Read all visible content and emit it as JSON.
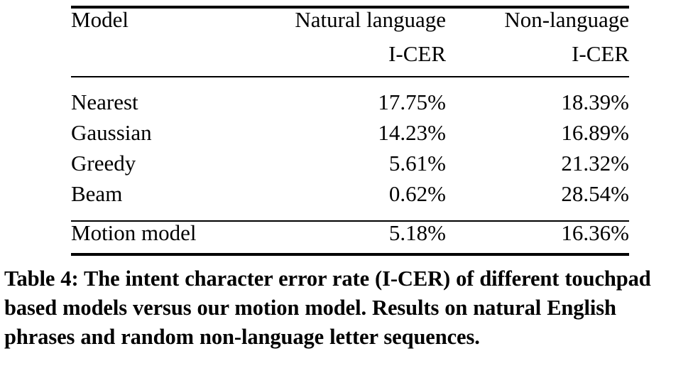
{
  "table": {
    "columns": [
      {
        "id": "model",
        "header_line1": "Model",
        "header_line2": "",
        "align": "left"
      },
      {
        "id": "natural_language",
        "header_line1": "Natural language",
        "header_line2": "I-CER",
        "align": "right"
      },
      {
        "id": "non_language",
        "header_line1": "Non-language",
        "header_line2": "I-CER",
        "align": "right"
      }
    ],
    "rows": [
      {
        "model": "Nearest",
        "natural_language": "17.75%",
        "non_language": "18.39%"
      },
      {
        "model": "Gaussian",
        "natural_language": "14.23%",
        "non_language": "16.89%"
      },
      {
        "model": "Greedy",
        "natural_language": "5.61%",
        "non_language": "21.32%"
      },
      {
        "model": "Beam",
        "natural_language": "0.62%",
        "non_language": "28.54%"
      }
    ],
    "summary_rows": [
      {
        "model": "Motion model",
        "natural_language": "5.18%",
        "non_language": "16.36%"
      }
    ]
  },
  "caption": {
    "label": "Table 4:",
    "text": "The intent character error rate (I-CER) of different touchpad based models versus our motion model. Results on natural English phrases and random non-language letter sequences.",
    "full": "Table 4: The intent character error rate (I-CER) of different touchpad based models versus our motion model. Results on natural English phrases and random non-language letter sequences."
  },
  "chart_data": {
    "type": "table",
    "title": "Table 4: The intent character error rate (I-CER) of different touchpad based models versus our motion model. Results on natural English phrases and random non-language letter sequences.",
    "categories": [
      "Nearest",
      "Gaussian",
      "Greedy",
      "Beam",
      "Motion model"
    ],
    "series": [
      {
        "name": "Natural language I-CER",
        "values": [
          17.75,
          14.23,
          5.61,
          0.62,
          5.18
        ],
        "unit": "%"
      },
      {
        "name": "Non-language I-CER",
        "values": [
          18.39,
          16.89,
          21.32,
          28.54,
          16.36
        ],
        "unit": "%"
      }
    ],
    "xlabel": "Model",
    "ylabel": "I-CER",
    "grid": false,
    "legend": "none"
  }
}
